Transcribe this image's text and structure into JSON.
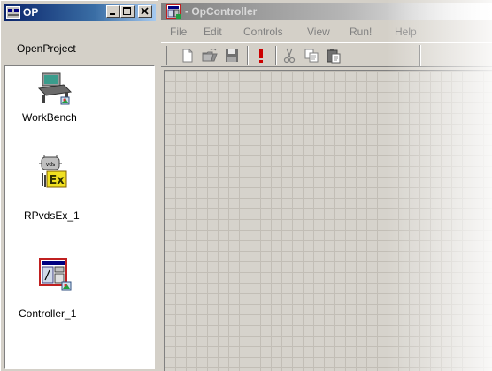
{
  "op_window": {
    "title": "OP",
    "header_label": "OpenProject",
    "items": [
      {
        "label": "WorkBench",
        "icon": "workbench-icon"
      },
      {
        "label": "RPvdsEx_1",
        "icon": "rpvdsex-icon"
      },
      {
        "label": "Controller_1",
        "icon": "controller-icon"
      }
    ]
  },
  "controller_window": {
    "title": "- OpController",
    "menu": [
      "File",
      "Edit",
      "Controls",
      "View",
      "Run!",
      "Help"
    ],
    "toolbar": [
      "new-file-icon",
      "open-folder-icon",
      "save-icon",
      "run-icon",
      "cut-icon",
      "copy-icon",
      "paste-icon"
    ]
  },
  "colors": {
    "active_title": "#0a246a",
    "inactive_title": "#808080",
    "face": "#d4d0c8",
    "run_red": "#cc0000"
  }
}
